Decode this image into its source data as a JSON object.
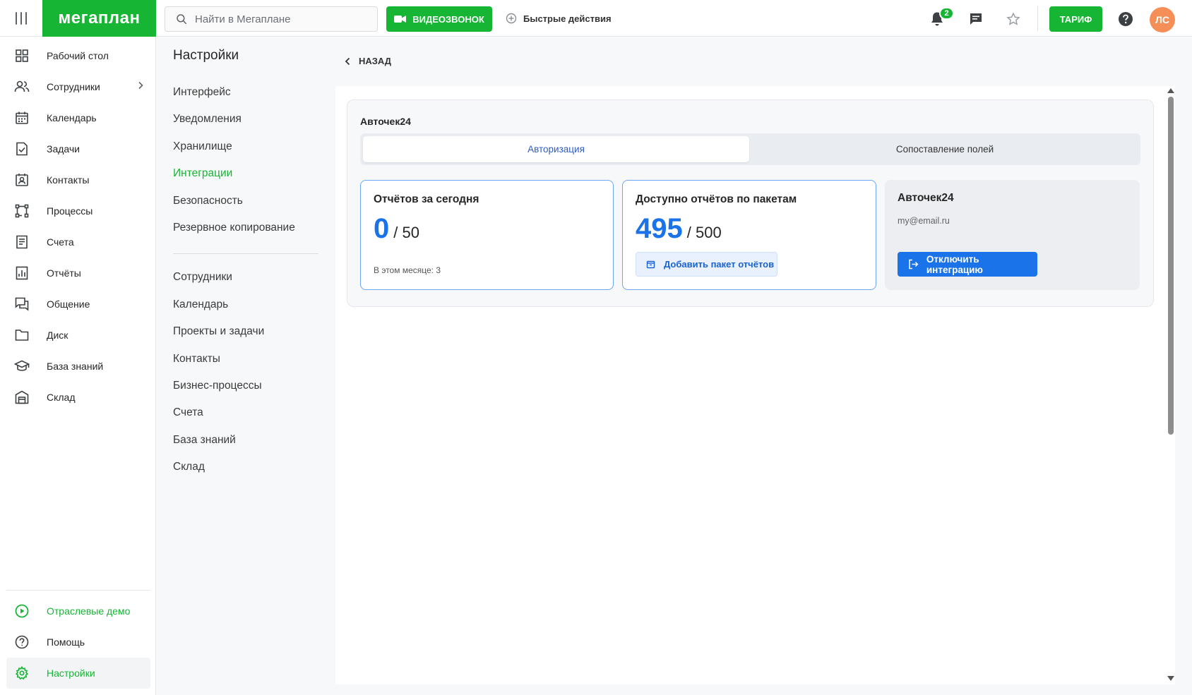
{
  "header": {
    "logo": "мегаплан",
    "search_placeholder": "Найти в Мегаплане",
    "video_call_label": "ВИДЕОЗВОНОК",
    "quick_actions_label": "Быстрые действия",
    "notifications_count": "2",
    "tariff_label": "ТАРИФ",
    "avatar_initials": "ЛС",
    "accent_color": "#16b534"
  },
  "sidebar": {
    "items": [
      {
        "label": "Рабочий стол",
        "icon": "dashboard-icon"
      },
      {
        "label": "Сотрудники",
        "icon": "users-icon"
      },
      {
        "label": "Календарь",
        "icon": "calendar-icon"
      },
      {
        "label": "Задачи",
        "icon": "tasks-icon"
      },
      {
        "label": "Контакты",
        "icon": "contacts-icon"
      },
      {
        "label": "Процессы",
        "icon": "processes-icon"
      },
      {
        "label": "Счета",
        "icon": "invoices-icon"
      },
      {
        "label": "Отчёты",
        "icon": "reports-icon"
      },
      {
        "label": "Общение",
        "icon": "chat-icon"
      },
      {
        "label": "Диск",
        "icon": "folder-icon"
      },
      {
        "label": "База знаний",
        "icon": "knowledge-icon"
      },
      {
        "label": "Склад",
        "icon": "warehouse-icon"
      }
    ],
    "bottom": [
      {
        "label": "Отраслевые демо",
        "icon": "play-icon"
      },
      {
        "label": "Помощь",
        "icon": "help-icon"
      },
      {
        "label": "Настройки",
        "icon": "gear-icon"
      }
    ]
  },
  "settings_menu": {
    "title": "Настройки",
    "group1": [
      "Интерфейс",
      "Уведомления",
      "Хранилище",
      "Интеграции",
      "Безопасность",
      "Резервное копирование"
    ],
    "group2": [
      "Сотрудники",
      "Календарь",
      "Проекты и задачи",
      "Контакты",
      "Бизнес-процессы",
      "Счета",
      "База знаний",
      "Склад"
    ],
    "active": "Интеграции"
  },
  "content": {
    "back_label": "НАЗАД",
    "integration_title": "Авточек24",
    "tabs": [
      {
        "label": "Авторизация",
        "active": true
      },
      {
        "label": "Сопоставление полей",
        "active": false
      }
    ],
    "reports_today": {
      "label": "Отчётов за сегодня",
      "value": "0",
      "limit": "/ 50",
      "month_note": "В этом месяце: 3"
    },
    "reports_available": {
      "label": "Доступно отчётов по пакетам",
      "value": "495",
      "limit": "/ 500",
      "add_button": "Добавить пакет отчётов"
    },
    "account": {
      "name": "Авточек24",
      "email": "my@email.ru",
      "disconnect_button": "Отключить интеграцию"
    }
  }
}
